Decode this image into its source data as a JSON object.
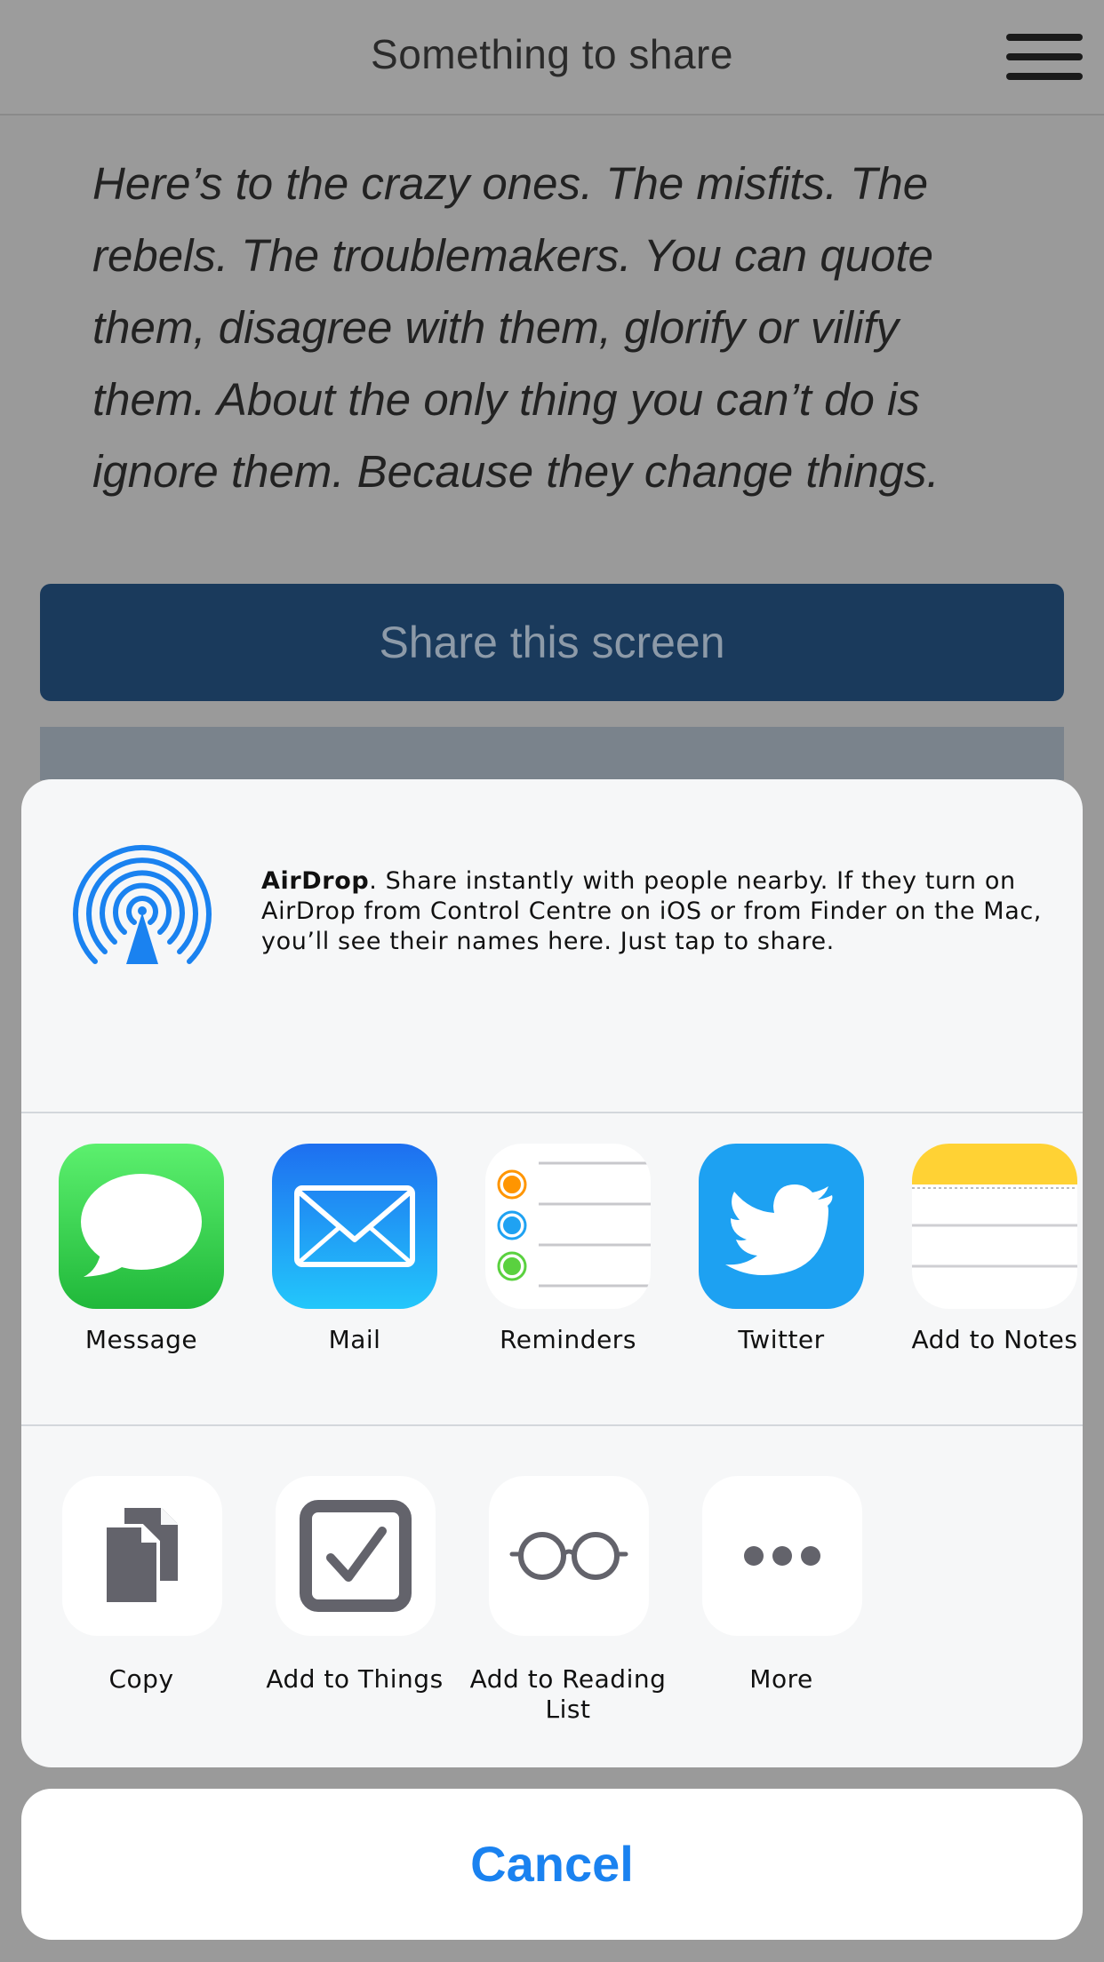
{
  "navbar": {
    "title": "Something to share"
  },
  "quote": "Here’s to the crazy ones. The misfits. The rebels. The troublemakers. You can quote them, disagree with them, glorify or vilify them. About the only thing you can’t do is ignore them. Because they change things.",
  "share_button": "Share this screen",
  "airdrop": {
    "title": "AirDrop",
    "description": ". Share instantly with people nearby. If they turn on AirDrop from Control Centre on iOS or from Finder on the Mac, you’ll see their names here. Just tap to share."
  },
  "apps": [
    {
      "label": "Message",
      "icon": "message-icon"
    },
    {
      "label": "Mail",
      "icon": "mail-icon"
    },
    {
      "label": "Reminders",
      "icon": "reminders-icon"
    },
    {
      "label": "Twitter",
      "icon": "twitter-icon"
    },
    {
      "label": "Add to Notes",
      "icon": "notes-icon"
    }
  ],
  "actions": [
    {
      "label": "Copy",
      "icon": "copy-icon"
    },
    {
      "label": "Add to Things",
      "icon": "checkbox-icon"
    },
    {
      "label": "Add to Reading List",
      "icon": "glasses-icon"
    },
    {
      "label": "More",
      "icon": "more-icon"
    }
  ],
  "cancel_label": "Cancel",
  "colors": {
    "accent": "#1a82f0",
    "share_button_bg": "#1a3a5c",
    "message_green": "#2ecc40",
    "twitter_blue": "#1da1f2",
    "notes_yellow": "#ffd234"
  }
}
